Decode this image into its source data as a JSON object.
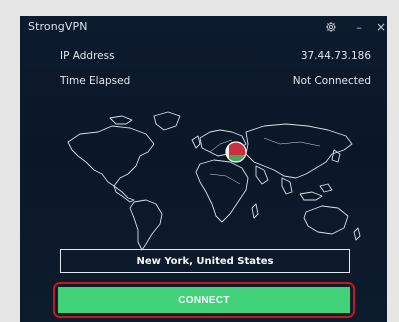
{
  "app": {
    "title": "StrongVPN"
  },
  "window_controls": {
    "settings_icon": "gear-icon",
    "minimize_icon": "minimize-icon",
    "close_icon": "close-icon",
    "minimize_glyph": "–",
    "close_glyph": "×",
    "settings_glyph": "⚙"
  },
  "info": {
    "ip_label": "IP Address",
    "ip_value": "37.44.73.186",
    "time_label": "Time Elapsed",
    "time_value": "Not Connected"
  },
  "map": {
    "icon": "world-map",
    "marker_icon": "belarus-flag-marker"
  },
  "location": {
    "selected": "New York, United States"
  },
  "connect": {
    "label": "CONNECT"
  },
  "colors": {
    "background": "#0c1b2e",
    "connect_green": "#41d27a",
    "highlight_red": "#c11b1b"
  }
}
